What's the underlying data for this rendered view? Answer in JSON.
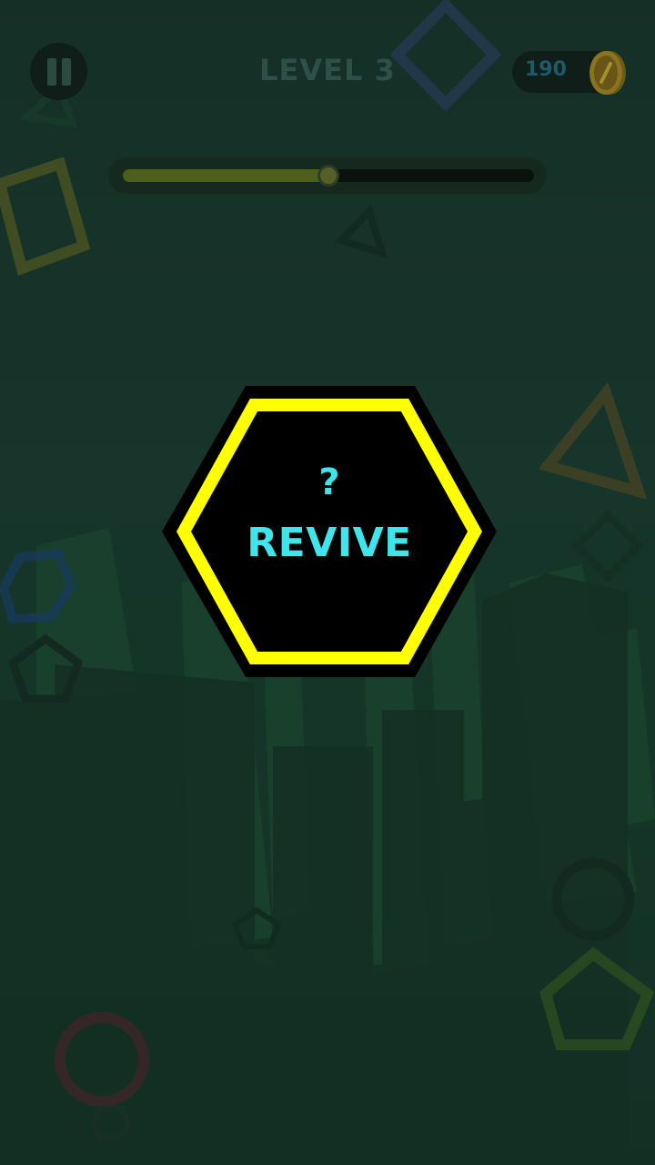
{
  "header": {
    "level_title": "LEVEL 3",
    "coin_count": "190",
    "pause_icon": "pause-icon",
    "coin_icon": "coin-icon"
  },
  "progress": {
    "fraction": 0.5
  },
  "revive": {
    "question": "?",
    "label": "REVIVE",
    "border_color": "#ffff00",
    "text_color": "#3ee6ec"
  },
  "theme": {
    "background": "#1f4236",
    "accent": "#ffff00"
  }
}
